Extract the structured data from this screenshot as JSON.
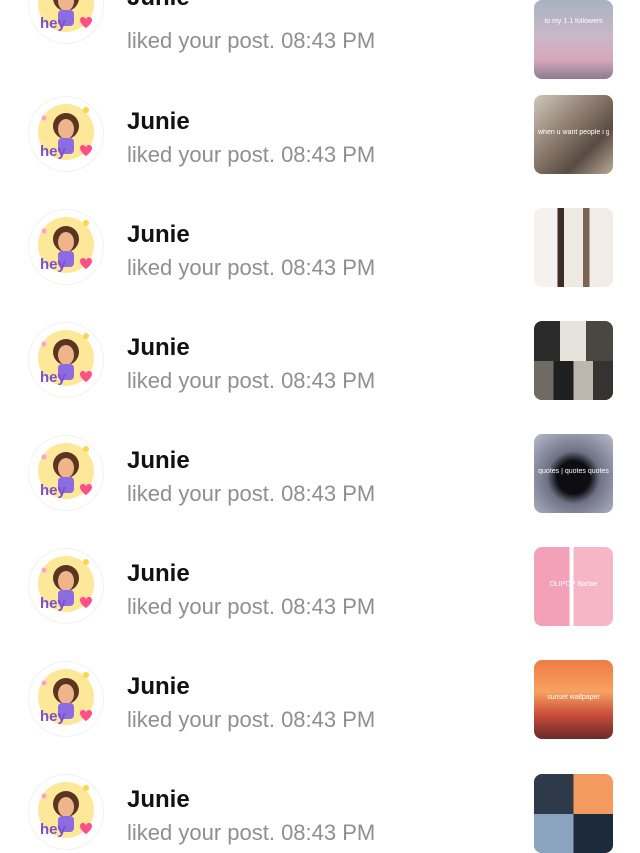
{
  "notifications": [
    {
      "name": "Junie",
      "text": "liked your post. 08:43 PM",
      "avatar_icon": "bitmoji-hey-icon",
      "thumb_caption": "to my 1.1 followers"
    },
    {
      "name": "Junie",
      "text": "liked your post. 08:43 PM",
      "avatar_icon": "bitmoji-hey-icon",
      "thumb_caption": "when u want people i get"
    },
    {
      "name": "Junie",
      "text": "liked your post. 08:43 PM",
      "avatar_icon": "bitmoji-hey-icon",
      "thumb_caption": ""
    },
    {
      "name": "Junie",
      "text": "liked your post. 08:43 PM",
      "avatar_icon": "bitmoji-hey-icon",
      "thumb_caption": ""
    },
    {
      "name": "Junie",
      "text": "liked your post. 08:43 PM",
      "avatar_icon": "bitmoji-hey-icon",
      "thumb_caption": "quotes | quotes quotes"
    },
    {
      "name": "Junie",
      "text": "liked your post. 08:43 PM",
      "avatar_icon": "bitmoji-hey-icon",
      "thumb_caption": "OLIPOP Barbie"
    },
    {
      "name": "Junie",
      "text": "liked your post. 08:43 PM",
      "avatar_icon": "bitmoji-hey-icon",
      "thumb_caption": "sunset wallpaper"
    },
    {
      "name": "Junie",
      "text": "liked your post. 08:43 PM",
      "avatar_icon": "bitmoji-hey-icon",
      "thumb_caption": ""
    }
  ],
  "colors": {
    "name": "#111111",
    "subtext": "#8f8f8f",
    "hey_text": "#7b4fd0",
    "heart": "#ff4f8b"
  }
}
